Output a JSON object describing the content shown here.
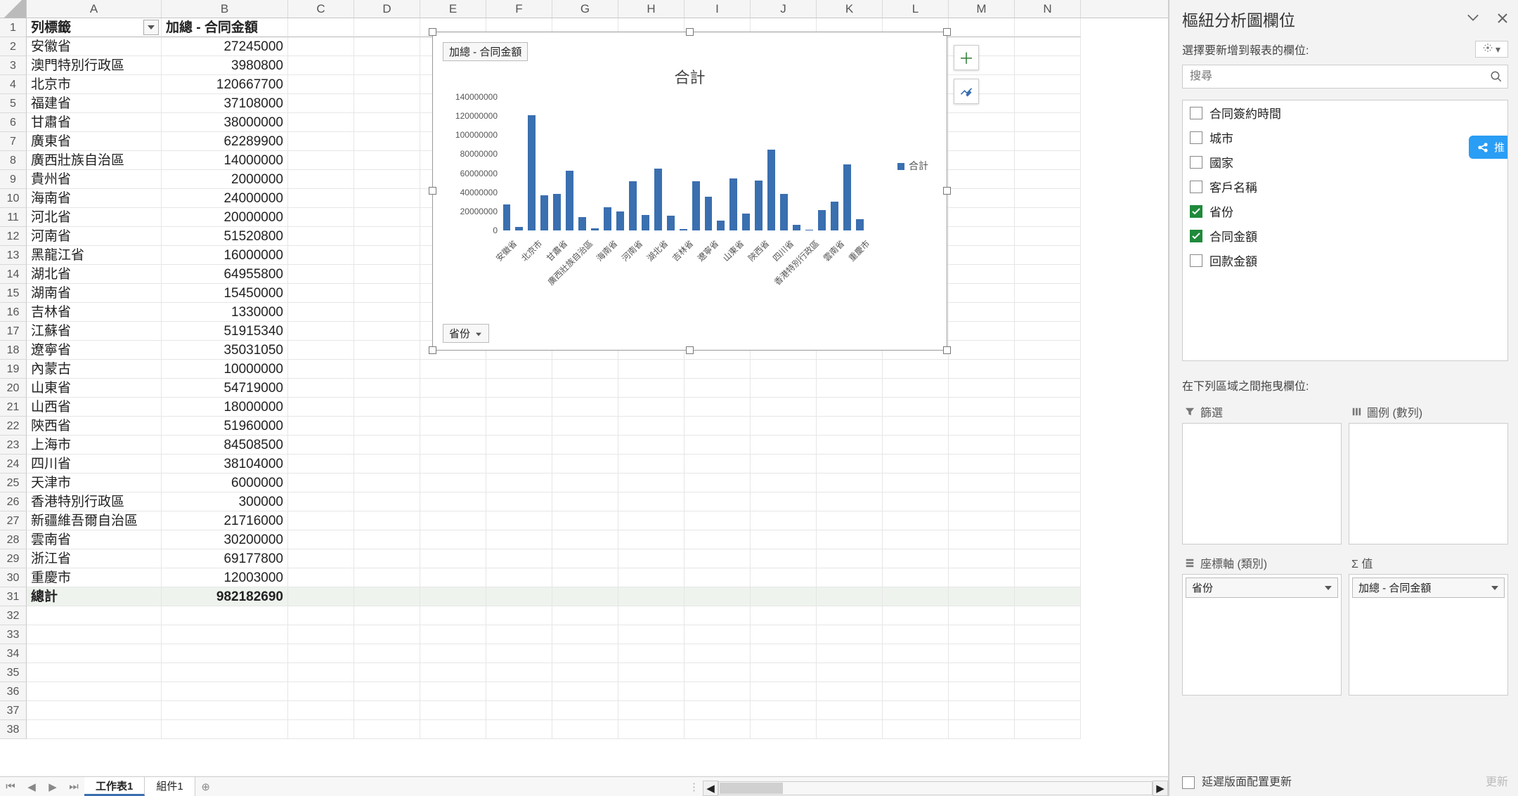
{
  "columns": [
    "A",
    "B",
    "C",
    "D",
    "E",
    "F",
    "G",
    "H",
    "I",
    "J",
    "K",
    "L",
    "M",
    "N"
  ],
  "header_row": {
    "a": "列標籤",
    "b": "加總 - 合同金額"
  },
  "data_rows": [
    {
      "a": "安徽省",
      "b": 27245000
    },
    {
      "a": "澳門特別行政區",
      "b": 3980800
    },
    {
      "a": "北京市",
      "b": 120667700
    },
    {
      "a": "福建省",
      "b": 37108000
    },
    {
      "a": "甘肅省",
      "b": 38000000
    },
    {
      "a": "廣東省",
      "b": 62289900
    },
    {
      "a": "廣西壯族自治區",
      "b": 14000000
    },
    {
      "a": "貴州省",
      "b": 2000000
    },
    {
      "a": "海南省",
      "b": 24000000
    },
    {
      "a": "河北省",
      "b": 20000000
    },
    {
      "a": "河南省",
      "b": 51520800
    },
    {
      "a": "黑龍江省",
      "b": 16000000
    },
    {
      "a": "湖北省",
      "b": 64955800
    },
    {
      "a": "湖南省",
      "b": 15450000
    },
    {
      "a": "吉林省",
      "b": 1330000
    },
    {
      "a": "江蘇省",
      "b": 51915340
    },
    {
      "a": "遼寧省",
      "b": 35031050
    },
    {
      "a": "內蒙古",
      "b": 10000000
    },
    {
      "a": "山東省",
      "b": 54719000
    },
    {
      "a": "山西省",
      "b": 18000000
    },
    {
      "a": "陝西省",
      "b": 51960000
    },
    {
      "a": "上海市",
      "b": 84508500
    },
    {
      "a": "四川省",
      "b": 38104000
    },
    {
      "a": "天津市",
      "b": 6000000
    },
    {
      "a": "香港特別行政區",
      "b": 300000
    },
    {
      "a": "新疆維吾爾自治區",
      "b": 21716000
    },
    {
      "a": "雲南省",
      "b": 30200000
    },
    {
      "a": "浙江省",
      "b": 69177800
    },
    {
      "a": "重慶市",
      "b": 12003000
    }
  ],
  "total_row": {
    "a": "總計",
    "b": 982182690
  },
  "chart_data": {
    "type": "bar",
    "tag": "加總 - 合同金額",
    "title": "合計",
    "legend": "合計",
    "filter": "省份",
    "ylim": [
      0,
      140000000
    ],
    "yticks": [
      0,
      20000000,
      40000000,
      60000000,
      80000000,
      100000000,
      120000000,
      140000000
    ],
    "xlabels_shown": [
      "安徽省",
      "北京市",
      "甘肅省",
      "廣西壯族自治區",
      "海南省",
      "河南省",
      "湖北省",
      "吉林省",
      "遼寧省",
      "山東省",
      "陝西省",
      "四川省",
      "香港特別行政區",
      "雲南省",
      "重慶市"
    ],
    "categories": [
      "安徽省",
      "澳門特別行政區",
      "北京市",
      "福建省",
      "甘肅省",
      "廣東省",
      "廣西壯族自治區",
      "貴州省",
      "海南省",
      "河北省",
      "河南省",
      "黑龍江省",
      "湖北省",
      "湖南省",
      "吉林省",
      "江蘇省",
      "遼寧省",
      "內蒙古",
      "山東省",
      "山西省",
      "陝西省",
      "上海市",
      "四川省",
      "天津市",
      "香港特別行政區",
      "新疆維吾爾自治區",
      "雲南省",
      "浙江省",
      "重慶市"
    ],
    "values": [
      27245000,
      3980800,
      120667700,
      37108000,
      38000000,
      62289900,
      14000000,
      2000000,
      24000000,
      20000000,
      51520800,
      16000000,
      64955800,
      15450000,
      1330000,
      51915340,
      35031050,
      10000000,
      54719000,
      18000000,
      51960000,
      84508500,
      38104000,
      6000000,
      300000,
      21716000,
      30200000,
      69177800,
      12003000
    ]
  },
  "sheet_tabs": {
    "active": "工作表1",
    "other": "組件1"
  },
  "panel": {
    "title": "樞紐分析圖欄位",
    "subtitle": "選擇要新增到報表的欄位:",
    "search_placeholder": "搜尋",
    "float_btn": "推",
    "fields": [
      {
        "label": "合同簽約時間",
        "checked": false
      },
      {
        "label": "城市",
        "checked": false
      },
      {
        "label": "國家",
        "checked": false
      },
      {
        "label": "客戶名稱",
        "checked": false
      },
      {
        "label": "省份",
        "checked": true
      },
      {
        "label": "合同金額",
        "checked": true
      },
      {
        "label": "回款金額",
        "checked": false
      }
    ],
    "areas_label": "在下列區域之間拖曳欄位:",
    "area_filter": "篩選",
    "area_legend": "圖例 (數列)",
    "area_axis": "座標軸 (類別)",
    "area_values": "Σ  值",
    "axis_chip": "省份",
    "values_chip": "加總 - 合同金額",
    "defer": "延遲版面配置更新",
    "update": "更新"
  }
}
